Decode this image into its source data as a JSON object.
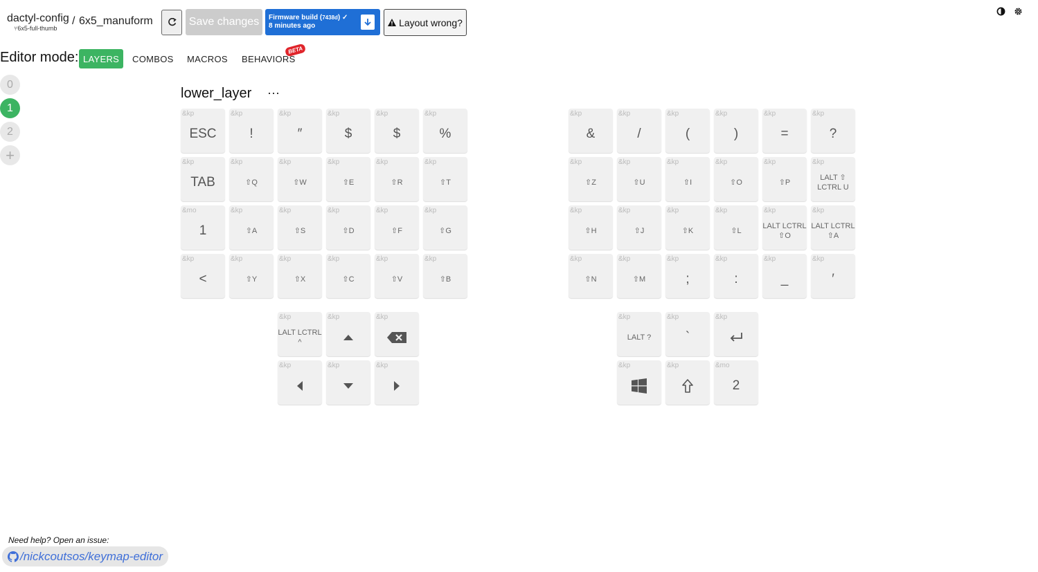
{
  "header": {
    "repo": "dactyl-config",
    "branch": "6x5-full-thumb",
    "separator": "/",
    "keyboard": "6x5_manuform",
    "save_label": "Save changes",
    "firmware_label": "Firmware build (",
    "firmware_hash": "7438d",
    "firmware_close": ")",
    "firmware_time": "8 minutes ago",
    "layout_wrong_label": "Layout wrong?"
  },
  "editor": {
    "label": "Editor mode:",
    "modes": [
      "LAYERS",
      "COMBOS",
      "MACROS",
      "BEHAVIORS"
    ],
    "active_mode": "LAYERS",
    "beta_badge": "BETA"
  },
  "layers": {
    "items": [
      "0",
      "1",
      "2"
    ],
    "add": "+",
    "active": "1",
    "current_name": "lower_layer",
    "more": "···"
  },
  "keys": {
    "left": [
      [
        {
          "b": "&kp",
          "l": "ESC",
          "s": "big"
        },
        {
          "b": "&kp",
          "l": "!",
          "s": "big"
        },
        {
          "b": "&kp",
          "l": "″",
          "s": "big"
        },
        {
          "b": "&kp",
          "l": "$",
          "s": "big"
        },
        {
          "b": "&kp",
          "l": "$",
          "s": "big"
        },
        {
          "b": "&kp",
          "l": "%",
          "s": "big"
        }
      ],
      [
        {
          "b": "&kp",
          "l": "TAB",
          "s": "big"
        },
        {
          "b": "&kp",
          "l": "⇧Q",
          "s": "sm"
        },
        {
          "b": "&kp",
          "l": "⇧W",
          "s": "sm"
        },
        {
          "b": "&kp",
          "l": "⇧E",
          "s": "sm"
        },
        {
          "b": "&kp",
          "l": "⇧R",
          "s": "sm"
        },
        {
          "b": "&kp",
          "l": "⇧T",
          "s": "sm"
        }
      ],
      [
        {
          "b": "&mo",
          "l": "1",
          "s": "big"
        },
        {
          "b": "&kp",
          "l": "⇧A",
          "s": "sm"
        },
        {
          "b": "&kp",
          "l": "⇧S",
          "s": "sm"
        },
        {
          "b": "&kp",
          "l": "⇧D",
          "s": "sm"
        },
        {
          "b": "&kp",
          "l": "⇧F",
          "s": "sm"
        },
        {
          "b": "&kp",
          "l": "⇧G",
          "s": "sm"
        }
      ],
      [
        {
          "b": "&kp",
          "l": "<",
          "s": "big"
        },
        {
          "b": "&kp",
          "l": "⇧Y",
          "s": "sm"
        },
        {
          "b": "&kp",
          "l": "⇧X",
          "s": "sm"
        },
        {
          "b": "&kp",
          "l": "⇧C",
          "s": "sm"
        },
        {
          "b": "&kp",
          "l": "⇧V",
          "s": "sm"
        },
        {
          "b": "&kp",
          "l": "⇧B",
          "s": "sm"
        }
      ]
    ],
    "right": [
      [
        {
          "b": "&kp",
          "l": "&",
          "s": "big"
        },
        {
          "b": "&kp",
          "l": "/",
          "s": "big"
        },
        {
          "b": "&kp",
          "l": "(",
          "s": "big"
        },
        {
          "b": "&kp",
          "l": ")",
          "s": "big"
        },
        {
          "b": "&kp",
          "l": "=",
          "s": "big"
        },
        {
          "b": "&kp",
          "l": "?",
          "s": "big"
        }
      ],
      [
        {
          "b": "&kp",
          "l": "⇧Z",
          "s": "sm"
        },
        {
          "b": "&kp",
          "l": "⇧U",
          "s": "sm"
        },
        {
          "b": "&kp",
          "l": "⇧I",
          "s": "sm"
        },
        {
          "b": "&kp",
          "l": "⇧O",
          "s": "sm"
        },
        {
          "b": "&kp",
          "l": "⇧P",
          "s": "sm"
        },
        {
          "b": "&kp",
          "l": "LALT ⇧ LCTRL U",
          "s": "sm"
        }
      ],
      [
        {
          "b": "&kp",
          "l": "⇧H",
          "s": "sm"
        },
        {
          "b": "&kp",
          "l": "⇧J",
          "s": "sm"
        },
        {
          "b": "&kp",
          "l": "⇧K",
          "s": "sm"
        },
        {
          "b": "&kp",
          "l": "⇧L",
          "s": "sm"
        },
        {
          "b": "&kp",
          "l": "LALT LCTRL ⇧O",
          "s": "sm"
        },
        {
          "b": "&kp",
          "l": "LALT LCTRL ⇧A",
          "s": "sm"
        }
      ],
      [
        {
          "b": "&kp",
          "l": "⇧N",
          "s": "sm"
        },
        {
          "b": "&kp",
          "l": "⇧M",
          "s": "sm"
        },
        {
          "b": "&kp",
          "l": ";",
          "s": "big"
        },
        {
          "b": "&kp",
          "l": ":",
          "s": "big"
        },
        {
          "b": "&kp",
          "l": "_",
          "s": "big"
        },
        {
          "b": "&kp",
          "l": "′",
          "s": "big"
        }
      ]
    ],
    "left_thumb": [
      [
        {
          "b": "&kp",
          "l": "LALT LCTRL ^",
          "s": "sm"
        },
        {
          "b": "&kp",
          "icon": "arrow-up-icon"
        },
        {
          "b": "&kp",
          "icon": "backspace-icon"
        }
      ],
      [
        {
          "b": "&kp",
          "icon": "arrow-left-icon"
        },
        {
          "b": "&kp",
          "icon": "arrow-down-icon"
        },
        {
          "b": "&kp",
          "icon": "arrow-right-icon"
        }
      ]
    ],
    "right_thumb": [
      [
        {
          "b": "&kp",
          "l": "LALT ?",
          "s": "sm"
        },
        {
          "b": "&kp",
          "l": "`",
          "s": "big"
        },
        {
          "b": "&kp",
          "icon": "enter-icon"
        }
      ],
      [
        {
          "b": "&kp",
          "icon": "windows-icon"
        },
        {
          "b": "&kp",
          "icon": "shift-icon"
        },
        {
          "b": "&mo",
          "l": "2",
          "s": "big"
        }
      ]
    ]
  },
  "footer": {
    "help": "Need help? Open an issue:",
    "link": "/nickcoutsos/keymap-editor"
  },
  "colors": {
    "accent": "#3cb462",
    "primary": "#1f6fd6",
    "beta": "#e0252b",
    "link": "#3f6fd8"
  }
}
